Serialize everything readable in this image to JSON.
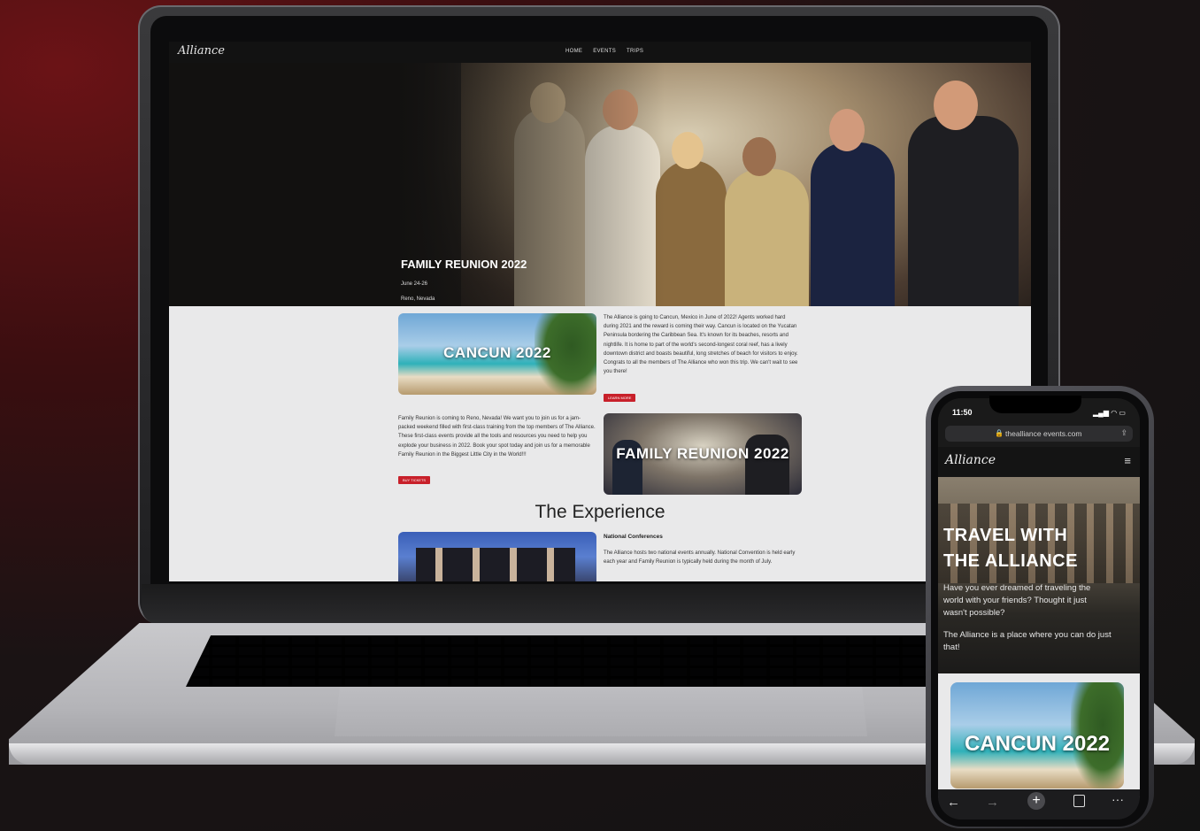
{
  "desktop": {
    "logo": "Alliance",
    "nav": [
      "HOME",
      "EVENTS",
      "TRIPS"
    ],
    "hero": {
      "title": "FAMILY REUNION 2022",
      "dates": "June 24-26",
      "location": "Reno, Nevada"
    },
    "cancun": {
      "image_label": "CANCUN 2022",
      "text": "The Alliance is going to Cancun, Mexico in June of 2022! Agents worked hard during 2021 and the reward is coming their way. Cancun is located on the Yucatan Peninsula bordering the Caribbean Sea. It's known for its beaches, resorts and nightlife. It is home to part of the world's second-longest coral reef, has a lively downtown district and boasts beautiful, long stretches of beach for visitors to enjoy. Congrats to all the members of The Alliance who won this trip. We can't wait to see you there!",
      "button": "LEARN MORE"
    },
    "reunion": {
      "image_label": "FAMILY REUNION 2022",
      "text": "Family Reunion is coming to Reno, Nevada! We want you to join us for a jam-packed weekend filled with first-class training from the top members of The Alliance. These first-class events provide all the tools and resources you need to help you explode your business in 2022. Book your spot today and join us for a memorable Family Reunion in the Biggest Little City in the World!!!",
      "button": "BUY TICKETS"
    },
    "experience": {
      "title": "The Experience",
      "subtitle": "National Conferences",
      "text": "The Alliance hosts two national events annually. National Convention is held early each year and Family Reunion is typically held during the month of July."
    }
  },
  "mobile": {
    "time": "11:50",
    "url": "thealliance events.com",
    "logo": "Alliance",
    "hero_title": "TRAVEL WITH THE ALLIANCE",
    "hero_text": "Have you ever dreamed of traveling the world with your friends? Thought it just wasn't possible?",
    "hero_text2": "The Alliance is a place where you can do just that!",
    "card_label": "CANCUN 2022"
  },
  "colors": {
    "accent": "#c8202a",
    "nav_bg": "#121212",
    "page_bg": "#e9e9ea"
  }
}
